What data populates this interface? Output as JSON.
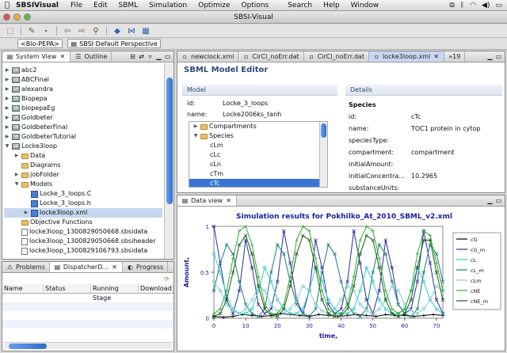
{
  "menubar": {
    "app": "SBSIVisual",
    "items": [
      "File",
      "Edit",
      "SBML",
      "Simulation",
      "Optimize",
      "Options",
      "Search",
      "Help",
      "Window"
    ]
  },
  "window": {
    "title": "SBSI-Visual"
  },
  "perspective": {
    "current": "<Bio-PEPA>",
    "default": "SBSI Default Perspective"
  },
  "left_tabs": {
    "system_view": "System View",
    "outline": "Outline"
  },
  "tree": [
    {
      "label": "abc2",
      "kind": "proj",
      "indent": 0,
      "arrow": "▶"
    },
    {
      "label": "ABCFinal",
      "kind": "proj",
      "indent": 0,
      "arrow": "▶"
    },
    {
      "label": "alexandra",
      "kind": "proj",
      "indent": 0,
      "arrow": "▶"
    },
    {
      "label": "Biopepa",
      "kind": "proj",
      "indent": 0,
      "arrow": "▶"
    },
    {
      "label": "biopepaEg",
      "kind": "proj",
      "indent": 0,
      "arrow": "▶"
    },
    {
      "label": "Goldbeter",
      "kind": "proj",
      "indent": 0,
      "arrow": "▶"
    },
    {
      "label": "GoldbeterFinal",
      "kind": "proj",
      "indent": 0,
      "arrow": "▶"
    },
    {
      "label": "GoldbeterTutorial",
      "kind": "proj",
      "indent": 0,
      "arrow": "▶"
    },
    {
      "label": "Locke3loop",
      "kind": "proj",
      "indent": 0,
      "arrow": "▼"
    },
    {
      "label": "Data",
      "kind": "folder",
      "indent": 1,
      "arrow": "▶"
    },
    {
      "label": "Diagrams",
      "kind": "folder",
      "indent": 1,
      "arrow": ""
    },
    {
      "label": "jobFolder",
      "kind": "folder",
      "indent": 1,
      "arrow": "▶"
    },
    {
      "label": "Models",
      "kind": "folder",
      "indent": 1,
      "arrow": "▼"
    },
    {
      "label": "Locke_3_loops.C",
      "kind": "model",
      "indent": 2,
      "arrow": ""
    },
    {
      "label": "Locke_3_loops.h",
      "kind": "model",
      "indent": 2,
      "arrow": ""
    },
    {
      "label": "locke3loop.xml",
      "kind": "model",
      "indent": 2,
      "arrow": "▶",
      "selected": true
    },
    {
      "label": "Objective Functions",
      "kind": "folder",
      "indent": 1,
      "arrow": ""
    },
    {
      "label": "locke3loop_1300829050668.sbsidata",
      "kind": "file",
      "indent": 1,
      "arrow": ""
    },
    {
      "label": "locke3loop_1300829050668.sbsiheader",
      "kind": "file",
      "indent": 1,
      "arrow": ""
    },
    {
      "label": "locke3loop_1300829106793.sbsidata",
      "kind": "file",
      "indent": 1,
      "arrow": ""
    },
    {
      "label": "locke3loop_1300829106793.sbsiheader",
      "kind": "file",
      "indent": 1,
      "arrow": ""
    }
  ],
  "bottom_tabs": {
    "problems": "Problems",
    "dispatcher": "DispatcherD...",
    "progress": "Progress"
  },
  "bottom_table": {
    "columns": [
      "Name",
      "Status",
      "Running Stage",
      "Download"
    ]
  },
  "editor_tabs": [
    "newclock.xml",
    "CirCl_noErr.dat",
    "CirCl_noErr.dat",
    "locke3loop.xml",
    "»19"
  ],
  "editor": {
    "title": "SBML Model Editor",
    "model_label": "Model",
    "details_label": "Details",
    "id_key": "id:",
    "id_val": "Locke_3_loops",
    "name_key": "name:",
    "name_val": "Locke2006ks_tanh",
    "tree": [
      {
        "label": "Compartments",
        "arrow": "▶",
        "indent": 0,
        "folder": true
      },
      {
        "label": "Species",
        "arrow": "▼",
        "indent": 0,
        "folder": true
      },
      {
        "label": "cLm",
        "arrow": "",
        "indent": 1
      },
      {
        "label": "cLc",
        "arrow": "",
        "indent": 1
      },
      {
        "label": "cLn",
        "arrow": "",
        "indent": 1
      },
      {
        "label": "cTm",
        "arrow": "",
        "indent": 1
      },
      {
        "label": "cTc",
        "arrow": "",
        "indent": 1,
        "selected": true
      }
    ],
    "details": {
      "header": "Species",
      "rows": [
        {
          "k": "id:",
          "v": "cTc"
        },
        {
          "k": "name:",
          "v": "TOC1 protein  in cytop"
        },
        {
          "k": "speciesType:",
          "v": ""
        },
        {
          "k": "compartment:",
          "v": "compartment"
        },
        {
          "k": "initialAmount:",
          "v": ""
        },
        {
          "k": "initialConcentra...",
          "v": "10.2965"
        },
        {
          "k": "substanceUnits:",
          "v": ""
        }
      ]
    }
  },
  "data_view": {
    "tab": "Data view"
  },
  "chart_data": {
    "type": "line",
    "title": "Simulation results for Pokhilko_At_2010_SBML_v2.xml",
    "xlabel": "time,",
    "ylabel": "Amount,",
    "xlim": [
      0,
      72
    ],
    "ylim": [
      0,
      1
    ],
    "xticks": [
      0,
      10,
      20,
      30,
      40,
      50,
      60,
      70
    ],
    "yticks": [
      0,
      0.5,
      1
    ],
    "legend_position": "right",
    "series": [
      {
        "name": "cG",
        "color": "#000000",
        "marker": "+",
        "x": [
          0,
          3,
          6,
          9,
          12,
          15,
          18,
          21,
          24,
          27,
          30,
          33,
          36,
          39,
          42,
          45,
          48,
          51,
          54,
          57,
          60,
          63,
          66,
          69,
          72
        ],
        "values": [
          0.02,
          0.01,
          0.02,
          0.04,
          0.03,
          0.02,
          0.03,
          0.05,
          0.04,
          0.03,
          0.02,
          0.04,
          0.03,
          0.02,
          0.03,
          0.04,
          0.03,
          0.02,
          0.04,
          0.03,
          0.03,
          0.02,
          0.03,
          0.04,
          0.03
        ]
      },
      {
        "name": "cG_m",
        "color": "#2a2aa0",
        "marker": "x",
        "x": [
          0,
          2,
          4,
          6,
          8,
          10,
          12,
          14,
          16,
          18,
          20,
          22,
          24,
          26,
          28,
          30,
          32,
          34,
          36,
          38,
          40,
          42,
          44,
          46,
          48,
          50,
          52,
          54,
          56,
          58,
          60,
          62,
          64,
          66,
          68,
          70,
          72
        ],
        "values": [
          1.0,
          0.6,
          0.2,
          0.05,
          0.3,
          0.85,
          0.55,
          0.15,
          0.05,
          0.1,
          0.4,
          0.95,
          0.6,
          0.2,
          0.05,
          0.3,
          0.85,
          0.55,
          0.15,
          0.05,
          0.1,
          0.4,
          0.95,
          0.6,
          0.2,
          0.05,
          0.3,
          0.85,
          0.55,
          0.15,
          0.05,
          0.1,
          0.4,
          0.95,
          0.6,
          0.2,
          0.05
        ]
      },
      {
        "name": "cL",
        "color": "#33cccc",
        "marker": "o",
        "x": [
          0,
          2,
          4,
          6,
          8,
          10,
          12,
          14,
          16,
          18,
          20,
          22,
          24,
          26,
          28,
          30,
          32,
          34,
          36,
          38,
          40,
          42,
          44,
          46,
          48,
          50,
          52,
          54,
          56,
          58,
          60,
          62,
          64,
          66,
          68,
          70,
          72
        ],
        "values": [
          0.7,
          0.5,
          0.25,
          0.1,
          0.05,
          0.05,
          0.1,
          0.3,
          0.55,
          0.4,
          0.2,
          0.1,
          0.05,
          0.05,
          0.1,
          0.3,
          0.55,
          0.4,
          0.2,
          0.1,
          0.05,
          0.05,
          0.1,
          0.3,
          0.55,
          0.4,
          0.2,
          0.1,
          0.05,
          0.05,
          0.1,
          0.3,
          0.55,
          0.4,
          0.2,
          0.1,
          0.05
        ]
      },
      {
        "name": "cL_m",
        "color": "#1a7a7a",
        "marker": "x",
        "x": [
          0,
          2,
          4,
          6,
          8,
          10,
          12,
          14,
          16,
          18,
          20,
          22,
          24,
          26,
          28,
          30,
          32,
          34,
          36,
          38,
          40,
          42,
          44,
          46,
          48,
          50,
          52,
          54,
          56,
          58,
          60,
          62,
          64,
          66,
          68,
          70,
          72
        ],
        "values": [
          0.3,
          0.6,
          0.8,
          0.7,
          0.4,
          0.15,
          0.05,
          0.02,
          0.1,
          0.5,
          0.8,
          0.7,
          0.4,
          0.15,
          0.05,
          0.02,
          0.1,
          0.5,
          0.8,
          0.7,
          0.4,
          0.15,
          0.05,
          0.02,
          0.1,
          0.5,
          0.8,
          0.7,
          0.4,
          0.15,
          0.05,
          0.02,
          0.1,
          0.5,
          0.8,
          0.7,
          0.4
        ]
      },
      {
        "name": "cLm",
        "color": "#7fd0d0",
        "marker": "o",
        "x": [
          0,
          2,
          4,
          6,
          8,
          10,
          12,
          14,
          16,
          18,
          20,
          22,
          24,
          26,
          28,
          30,
          32,
          34,
          36,
          38,
          40,
          42,
          44,
          46,
          48,
          50,
          52,
          54,
          56,
          58,
          60,
          62,
          64,
          66,
          68,
          70,
          72
        ],
        "values": [
          0.4,
          0.3,
          0.15,
          0.08,
          0.05,
          0.1,
          0.2,
          0.35,
          0.3,
          0.15,
          0.08,
          0.05,
          0.1,
          0.2,
          0.35,
          0.3,
          0.15,
          0.08,
          0.05,
          0.1,
          0.2,
          0.35,
          0.3,
          0.15,
          0.08,
          0.05,
          0.1,
          0.2,
          0.35,
          0.3,
          0.15,
          0.08,
          0.05,
          0.1,
          0.2,
          0.35,
          0.3
        ]
      },
      {
        "name": "cNE",
        "color": "#33aa33",
        "marker": "+",
        "x": [
          0,
          2,
          4,
          6,
          8,
          10,
          12,
          14,
          16,
          18,
          20,
          22,
          24,
          26,
          28,
          30,
          32,
          34,
          36,
          38,
          40,
          42,
          44,
          46,
          48,
          50,
          52,
          54,
          56,
          58,
          60,
          62,
          64,
          66,
          68,
          70,
          72
        ],
        "values": [
          0.05,
          0.1,
          0.3,
          0.65,
          0.95,
          1.0,
          0.8,
          0.45,
          0.15,
          0.05,
          0.05,
          0.15,
          0.45,
          0.85,
          1.0,
          0.95,
          0.65,
          0.3,
          0.1,
          0.05,
          0.05,
          0.15,
          0.45,
          0.85,
          1.0,
          0.95,
          0.65,
          0.3,
          0.1,
          0.05,
          0.1,
          0.3,
          0.7,
          0.95,
          0.9,
          0.6,
          0.3
        ]
      },
      {
        "name": "cNE_m",
        "color": "#1a5a1a",
        "marker": "x",
        "x": [
          0,
          2,
          4,
          6,
          8,
          10,
          12,
          14,
          16,
          18,
          20,
          22,
          24,
          26,
          28,
          30,
          32,
          34,
          36,
          38,
          40,
          42,
          44,
          46,
          48,
          50,
          52,
          54,
          56,
          58,
          60,
          62,
          64,
          66,
          68,
          70,
          72
        ],
        "values": [
          0.02,
          0.05,
          0.2,
          0.5,
          0.8,
          0.9,
          0.7,
          0.35,
          0.1,
          0.03,
          0.02,
          0.1,
          0.35,
          0.7,
          0.9,
          0.85,
          0.55,
          0.2,
          0.05,
          0.02,
          0.03,
          0.1,
          0.35,
          0.7,
          0.9,
          0.85,
          0.55,
          0.2,
          0.05,
          0.02,
          0.05,
          0.2,
          0.55,
          0.85,
          0.85,
          0.5,
          0.2
        ]
      }
    ]
  },
  "colors": {
    "accent": "#3875d7",
    "selection": "#c7d7f0",
    "plot_title": "#2020a0"
  }
}
